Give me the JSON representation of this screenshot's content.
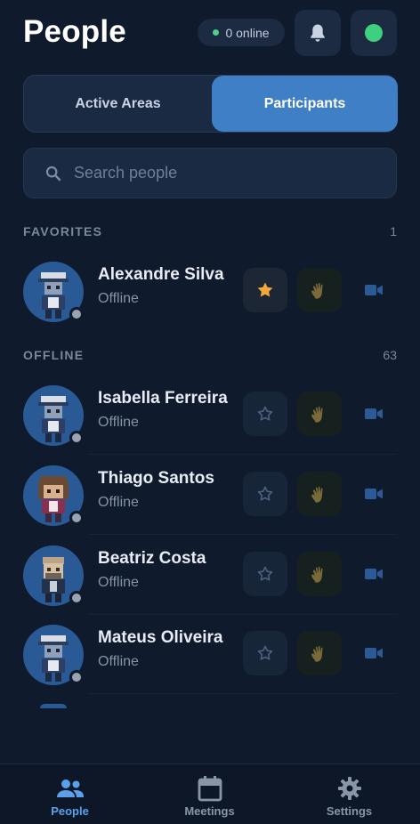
{
  "header": {
    "title": "People",
    "online_label": "0 online",
    "colors": {
      "online_dot": "#4fd18b",
      "status_dot": "#3fd07f"
    }
  },
  "tabs": [
    {
      "label": "Active Areas",
      "active": false
    },
    {
      "label": "Participants",
      "active": true
    }
  ],
  "search": {
    "placeholder": "Search people",
    "value": ""
  },
  "favorites": {
    "label": "FAVORITES",
    "count": "1",
    "people": [
      {
        "name": "Alexandre Silva",
        "status": "Offline",
        "favorite": true,
        "avatar": "police-cap-avatar"
      }
    ]
  },
  "offline": {
    "label": "OFFLINE",
    "count": "63",
    "people": [
      {
        "name": "Isabella Ferreira",
        "status": "Offline",
        "favorite": false,
        "avatar": "police-cap-avatar"
      },
      {
        "name": "Thiago Santos",
        "status": "Offline",
        "favorite": false,
        "avatar": "brown-hair-avatar"
      },
      {
        "name": "Beatriz Costa",
        "status": "Offline",
        "favorite": false,
        "avatar": "bearded-avatar"
      },
      {
        "name": "Mateus Oliveira",
        "status": "Offline",
        "favorite": false,
        "avatar": "police-cap-avatar"
      }
    ]
  },
  "nav": {
    "items": [
      {
        "label": "People",
        "icon": "people-icon",
        "active": true
      },
      {
        "label": "Meetings",
        "icon": "calendar-icon",
        "active": false
      },
      {
        "label": "Settings",
        "icon": "gear-icon",
        "active": false
      }
    ],
    "accent": "#5aa1ea"
  }
}
